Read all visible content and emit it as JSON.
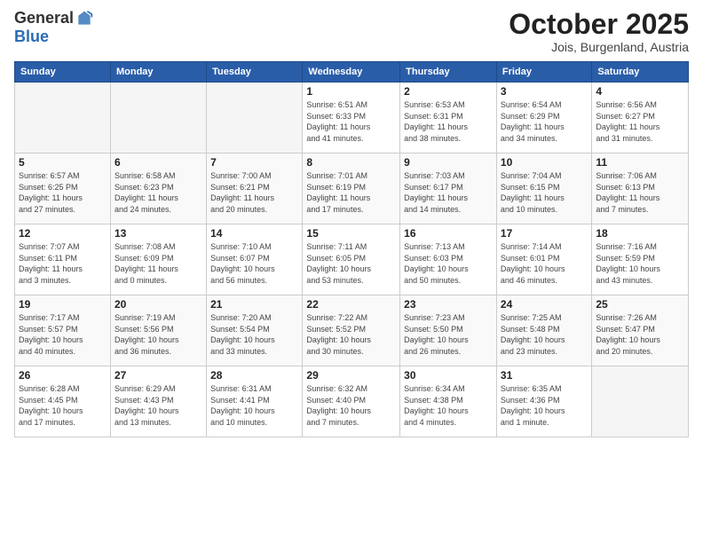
{
  "header": {
    "logo_general": "General",
    "logo_blue": "Blue",
    "month_title": "October 2025",
    "location": "Jois, Burgenland, Austria"
  },
  "days_of_week": [
    "Sunday",
    "Monday",
    "Tuesday",
    "Wednesday",
    "Thursday",
    "Friday",
    "Saturday"
  ],
  "weeks": [
    [
      {
        "day": "",
        "info": ""
      },
      {
        "day": "",
        "info": ""
      },
      {
        "day": "",
        "info": ""
      },
      {
        "day": "1",
        "info": "Sunrise: 6:51 AM\nSunset: 6:33 PM\nDaylight: 11 hours\nand 41 minutes."
      },
      {
        "day": "2",
        "info": "Sunrise: 6:53 AM\nSunset: 6:31 PM\nDaylight: 11 hours\nand 38 minutes."
      },
      {
        "day": "3",
        "info": "Sunrise: 6:54 AM\nSunset: 6:29 PM\nDaylight: 11 hours\nand 34 minutes."
      },
      {
        "day": "4",
        "info": "Sunrise: 6:56 AM\nSunset: 6:27 PM\nDaylight: 11 hours\nand 31 minutes."
      }
    ],
    [
      {
        "day": "5",
        "info": "Sunrise: 6:57 AM\nSunset: 6:25 PM\nDaylight: 11 hours\nand 27 minutes."
      },
      {
        "day": "6",
        "info": "Sunrise: 6:58 AM\nSunset: 6:23 PM\nDaylight: 11 hours\nand 24 minutes."
      },
      {
        "day": "7",
        "info": "Sunrise: 7:00 AM\nSunset: 6:21 PM\nDaylight: 11 hours\nand 20 minutes."
      },
      {
        "day": "8",
        "info": "Sunrise: 7:01 AM\nSunset: 6:19 PM\nDaylight: 11 hours\nand 17 minutes."
      },
      {
        "day": "9",
        "info": "Sunrise: 7:03 AM\nSunset: 6:17 PM\nDaylight: 11 hours\nand 14 minutes."
      },
      {
        "day": "10",
        "info": "Sunrise: 7:04 AM\nSunset: 6:15 PM\nDaylight: 11 hours\nand 10 minutes."
      },
      {
        "day": "11",
        "info": "Sunrise: 7:06 AM\nSunset: 6:13 PM\nDaylight: 11 hours\nand 7 minutes."
      }
    ],
    [
      {
        "day": "12",
        "info": "Sunrise: 7:07 AM\nSunset: 6:11 PM\nDaylight: 11 hours\nand 3 minutes."
      },
      {
        "day": "13",
        "info": "Sunrise: 7:08 AM\nSunset: 6:09 PM\nDaylight: 11 hours\nand 0 minutes."
      },
      {
        "day": "14",
        "info": "Sunrise: 7:10 AM\nSunset: 6:07 PM\nDaylight: 10 hours\nand 56 minutes."
      },
      {
        "day": "15",
        "info": "Sunrise: 7:11 AM\nSunset: 6:05 PM\nDaylight: 10 hours\nand 53 minutes."
      },
      {
        "day": "16",
        "info": "Sunrise: 7:13 AM\nSunset: 6:03 PM\nDaylight: 10 hours\nand 50 minutes."
      },
      {
        "day": "17",
        "info": "Sunrise: 7:14 AM\nSunset: 6:01 PM\nDaylight: 10 hours\nand 46 minutes."
      },
      {
        "day": "18",
        "info": "Sunrise: 7:16 AM\nSunset: 5:59 PM\nDaylight: 10 hours\nand 43 minutes."
      }
    ],
    [
      {
        "day": "19",
        "info": "Sunrise: 7:17 AM\nSunset: 5:57 PM\nDaylight: 10 hours\nand 40 minutes."
      },
      {
        "day": "20",
        "info": "Sunrise: 7:19 AM\nSunset: 5:56 PM\nDaylight: 10 hours\nand 36 minutes."
      },
      {
        "day": "21",
        "info": "Sunrise: 7:20 AM\nSunset: 5:54 PM\nDaylight: 10 hours\nand 33 minutes."
      },
      {
        "day": "22",
        "info": "Sunrise: 7:22 AM\nSunset: 5:52 PM\nDaylight: 10 hours\nand 30 minutes."
      },
      {
        "day": "23",
        "info": "Sunrise: 7:23 AM\nSunset: 5:50 PM\nDaylight: 10 hours\nand 26 minutes."
      },
      {
        "day": "24",
        "info": "Sunrise: 7:25 AM\nSunset: 5:48 PM\nDaylight: 10 hours\nand 23 minutes."
      },
      {
        "day": "25",
        "info": "Sunrise: 7:26 AM\nSunset: 5:47 PM\nDaylight: 10 hours\nand 20 minutes."
      }
    ],
    [
      {
        "day": "26",
        "info": "Sunrise: 6:28 AM\nSunset: 4:45 PM\nDaylight: 10 hours\nand 17 minutes."
      },
      {
        "day": "27",
        "info": "Sunrise: 6:29 AM\nSunset: 4:43 PM\nDaylight: 10 hours\nand 13 minutes."
      },
      {
        "day": "28",
        "info": "Sunrise: 6:31 AM\nSunset: 4:41 PM\nDaylight: 10 hours\nand 10 minutes."
      },
      {
        "day": "29",
        "info": "Sunrise: 6:32 AM\nSunset: 4:40 PM\nDaylight: 10 hours\nand 7 minutes."
      },
      {
        "day": "30",
        "info": "Sunrise: 6:34 AM\nSunset: 4:38 PM\nDaylight: 10 hours\nand 4 minutes."
      },
      {
        "day": "31",
        "info": "Sunrise: 6:35 AM\nSunset: 4:36 PM\nDaylight: 10 hours\nand 1 minute."
      },
      {
        "day": "",
        "info": ""
      }
    ]
  ]
}
